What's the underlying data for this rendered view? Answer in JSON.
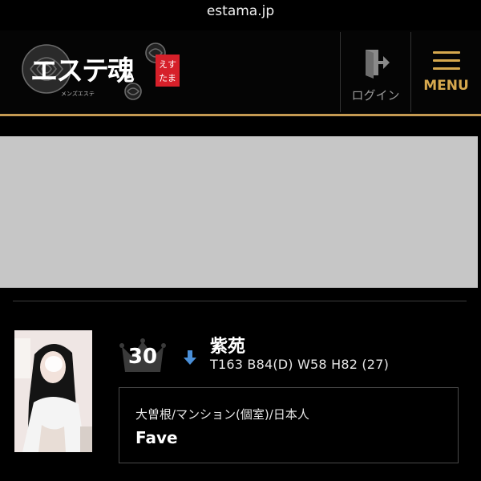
{
  "browser": {
    "url": "estama.jp"
  },
  "header": {
    "logo_text": "エステ魂",
    "logo_badge": "えすたま",
    "logo_sub": "メンズエステ",
    "login_label": "ログイン",
    "menu_label": "MENU",
    "accent_color": "#c49a52"
  },
  "listing": {
    "rank": "30",
    "rank_trend": "down",
    "name": "紫苑",
    "stats": "T163 B84(D) W58 H82 (27)",
    "area": "大曽根/マンション(個室)/日本人",
    "shop": "Fave"
  }
}
